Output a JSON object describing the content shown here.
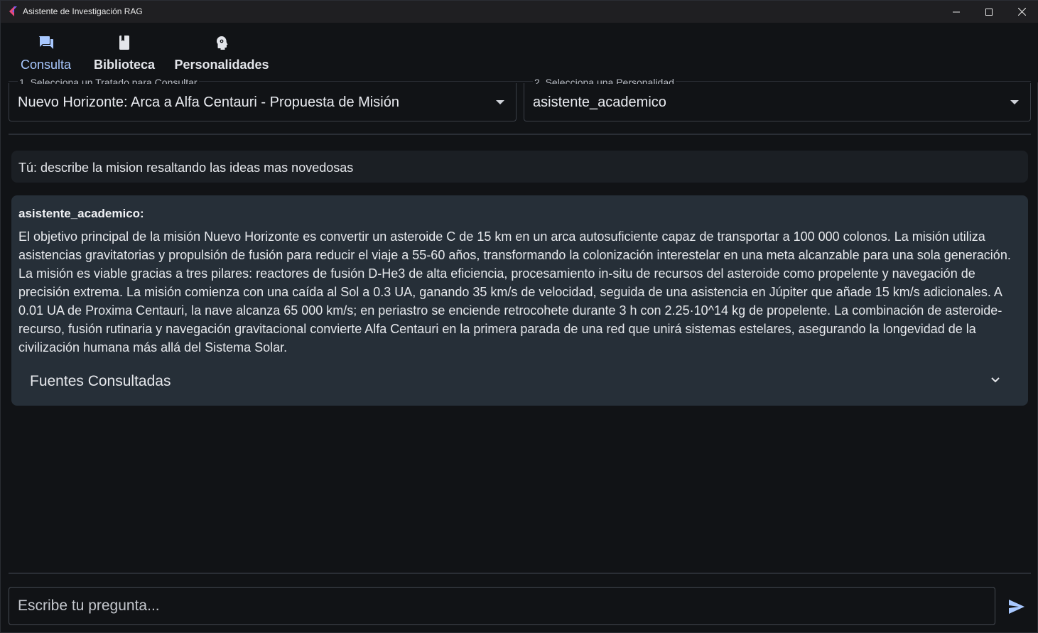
{
  "window": {
    "title": "Asistente de Investigación RAG"
  },
  "nav": {
    "tabs": [
      {
        "label": "Consulta",
        "icon": "chat-icon",
        "active": true
      },
      {
        "label": "Biblioteca",
        "icon": "book-icon",
        "active": false
      },
      {
        "label": "Personalidades",
        "icon": "psychology-icon",
        "active": false
      }
    ]
  },
  "selectors": {
    "treatise": {
      "label": "1. Selecciona un Tratado para Consultar",
      "value": "Nuevo Horizonte: Arca a Alfa Centauri - Propuesta de Misión"
    },
    "personality": {
      "label": "2. Selecciona una Personalidad",
      "value": "asistente_academico"
    }
  },
  "chat": {
    "user_message": "Tú: describe la mision resaltando las ideas mas novedosas",
    "bot_name": "asistente_academico:",
    "bot_message": "El objetivo principal de la misión Nuevo Horizonte es convertir un asteroide C de 15 km en un arca autosuficiente capaz de transportar a 100 000 colonos. La misión utiliza asistencias gravitatorias y propulsión de fusión para reducir el viaje a 55-60 años, transformando la colonización interestelar en una meta alcanzable para una sola generación. La misión es viable gracias a tres pilares: reactores de fusión D-He3 de alta eficiencia, procesamiento in-situ de recursos del asteroide como propelente y navegación de precisión extrema. La misión comienza con una caída al Sol a 0.3 UA, ganando 35 km/s de velocidad, seguida de una asistencia en Júpiter que añade 15 km/s adicionales. A 0.01 UA de Proxima Centauri, la nave alcanza 65 000 km/s; en periastro se enciende retrocohete durante 3 h con 2.25·10^14 kg de propelente. La combinación de asteroide-recurso, fusión rutinaria y navegación gravitacional convierte Alfa Centauri en la primera parada de una red que unirá sistemas estelares, asegurando la longevidad de la civilización humana más allá del Sistema Solar.",
    "sources_label": "Fuentes Consultadas"
  },
  "input": {
    "placeholder": "Escribe tu pregunta..."
  },
  "colors": {
    "background": "#111316",
    "accent": "#a8c8ff",
    "bot_bubble": "#262f38",
    "user_bubble": "#1b1f24"
  }
}
